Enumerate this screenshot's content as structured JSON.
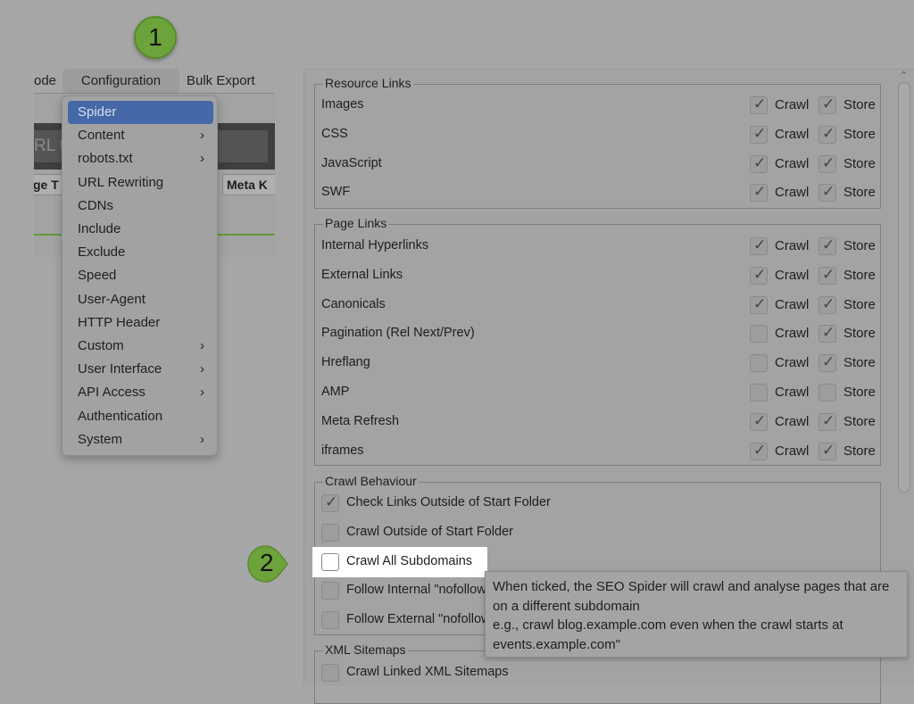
{
  "menubar": {
    "items": [
      "ode",
      "Configuration",
      "Bulk Export"
    ]
  },
  "background_app": {
    "url_placeholder_fragment": "RL to",
    "tab_fragments": [
      "ge T",
      "Meta K"
    ]
  },
  "menu": {
    "items": [
      {
        "label": "Spider",
        "selected": true,
        "submenu": false
      },
      {
        "label": "Content",
        "submenu": true
      },
      {
        "label": "robots.txt",
        "submenu": true
      },
      {
        "label": "URL Rewriting",
        "submenu": false
      },
      {
        "label": "CDNs",
        "submenu": false
      },
      {
        "label": "Include",
        "submenu": false
      },
      {
        "label": "Exclude",
        "submenu": false
      },
      {
        "label": "Speed",
        "submenu": false
      },
      {
        "label": "User-Agent",
        "submenu": false
      },
      {
        "label": "HTTP Header",
        "submenu": false
      },
      {
        "label": "Custom",
        "submenu": true
      },
      {
        "label": "User Interface",
        "submenu": true
      },
      {
        "label": "API Access",
        "submenu": true
      },
      {
        "label": "Authentication",
        "submenu": false
      },
      {
        "label": "System",
        "submenu": true
      }
    ],
    "chevron": "›"
  },
  "labels": {
    "crawl": "Crawl",
    "store": "Store"
  },
  "resource_links": {
    "title": "Resource Links",
    "rows": [
      {
        "label": "Images",
        "crawl": true,
        "store": true
      },
      {
        "label": "CSS",
        "crawl": true,
        "store": true
      },
      {
        "label": "JavaScript",
        "crawl": true,
        "store": true
      },
      {
        "label": "SWF",
        "crawl": true,
        "store": true
      }
    ]
  },
  "page_links": {
    "title": "Page Links",
    "rows": [
      {
        "label": "Internal Hyperlinks",
        "crawl": true,
        "store": true
      },
      {
        "label": "External Links",
        "crawl": true,
        "store": true
      },
      {
        "label": "Canonicals",
        "crawl": true,
        "store": true
      },
      {
        "label": "Pagination (Rel Next/Prev)",
        "crawl": false,
        "store": true
      },
      {
        "label": "Hreflang",
        "crawl": false,
        "store": true
      },
      {
        "label": "AMP",
        "crawl": false,
        "store": false
      },
      {
        "label": "Meta Refresh",
        "crawl": true,
        "store": true
      },
      {
        "label": "iframes",
        "crawl": true,
        "store": true
      }
    ]
  },
  "crawl_behaviour": {
    "title": "Crawl Behaviour",
    "rows": [
      {
        "label": "Check Links Outside of Start Folder",
        "checked": true
      },
      {
        "label": "Crawl Outside of Start Folder",
        "checked": false
      },
      {
        "label": "Crawl All Subdomains",
        "checked": false
      },
      {
        "label": "Follow Internal \"nofollow",
        "checked": false
      },
      {
        "label": "Follow External \"nofollow",
        "checked": false
      }
    ]
  },
  "xml_sitemaps": {
    "title": "XML Sitemaps",
    "rows": [
      {
        "label": "Crawl Linked XML Sitemaps",
        "checked": false
      }
    ]
  },
  "tooltip": {
    "lines": [
      "When ticked, the SEO Spider will crawl and analyse pages that are",
      "on a different subdomain",
      "e.g., crawl blog.example.com even when the crawl starts at",
      "events.example.com\""
    ]
  },
  "badges": {
    "step1": "1",
    "step2": "2",
    "color": "#6da33b"
  }
}
